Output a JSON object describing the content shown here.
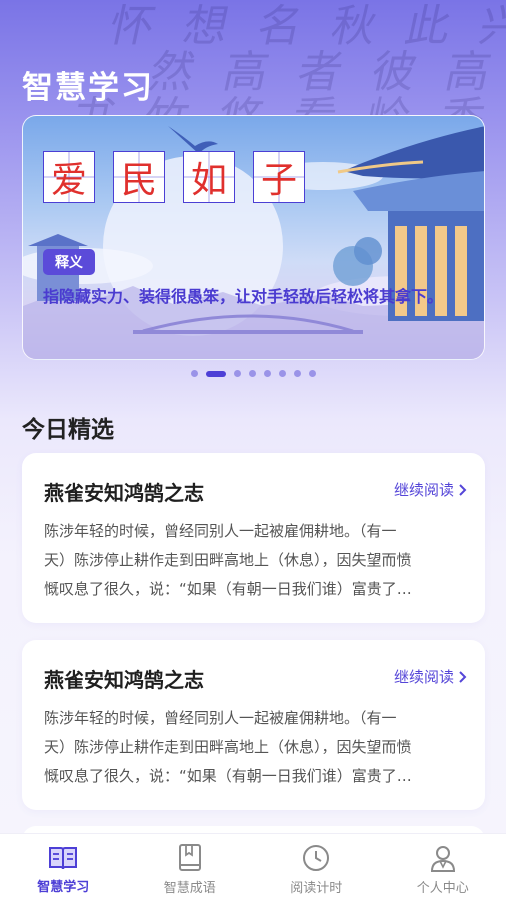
{
  "header": {
    "title": "智慧学习",
    "background_calligraphy": [
      "怀 想 名 秋 此 兴 来 发 波",
      "然 高 者 彼 高 以 赤 舟",
      "书 竹 悠 看 岭 香 傍 树 林"
    ]
  },
  "banner": {
    "idiom_chars": [
      "爱",
      "民",
      "如",
      "子"
    ],
    "meaning_tag": "释义",
    "meaning_text": "指隐藏实力、装得很愚笨，让对手轻敌后轻松将其拿下。",
    "page_count": 8,
    "active_page": 1
  },
  "section": {
    "title": "今日精选"
  },
  "articles": [
    {
      "title": "燕雀安知鸿鹄之志",
      "link_label": "继续阅读",
      "lines": [
        "陈涉年轻的时候，曾经同别人一起被雇佣耕地。（有一",
        "天）陈涉停止耕作走到田畔高地上（休息），因失望而愤",
        "慨叹息了很久，说：“如果（有朝一日我们谁）富贵了…"
      ]
    },
    {
      "title": "燕雀安知鸿鹄之志",
      "link_label": "继续阅读",
      "lines": [
        "陈涉年轻的时候，曾经同别人一起被雇佣耕地。（有一",
        "天）陈涉停止耕作走到田畔高地上（休息），因失望而愤",
        "慨叹息了很久，说：“如果（有朝一日我们谁）富贵了…"
      ]
    }
  ],
  "tabbar": {
    "items": [
      {
        "label": "智慧学习",
        "icon": "open-book-icon",
        "active": true
      },
      {
        "label": "智慧成语",
        "icon": "closed-book-icon",
        "active": false
      },
      {
        "label": "阅读计时",
        "icon": "clock-icon",
        "active": false
      },
      {
        "label": "个人中心",
        "icon": "user-icon",
        "active": false
      }
    ]
  },
  "colors": {
    "accent": "#4d3fd6",
    "idiom_char": "#e0302d",
    "inactive_tab": "#8a8a8a"
  }
}
